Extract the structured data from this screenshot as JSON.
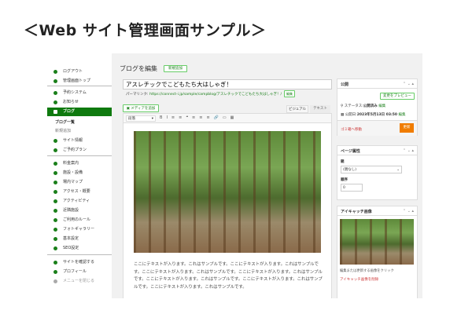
{
  "page_title": "＜Web サイト管理画面サンプル＞",
  "sidebar": {
    "items": [
      {
        "label": "ログアウト",
        "icon": "globe-icon"
      },
      {
        "label": "管理画面トップ",
        "icon": "home-icon"
      },
      {
        "label": "予約システム",
        "icon": "calendar-icon"
      },
      {
        "label": "お知らせ",
        "icon": "megaphone-icon"
      },
      {
        "label": "ブログ",
        "icon": "document-icon"
      },
      {
        "label": "ブログ一覧"
      },
      {
        "label": "新規追加"
      },
      {
        "label": "サイト情報",
        "icon": "house-icon"
      },
      {
        "label": "ご予約プラン",
        "icon": "tag-icon"
      },
      {
        "label": "料金案内",
        "icon": "receipt-icon"
      },
      {
        "label": "施設・設備",
        "icon": "flag-icon"
      },
      {
        "label": "場内マップ",
        "icon": "map-icon"
      },
      {
        "label": "アクセス・概要",
        "icon": "car-icon"
      },
      {
        "label": "アクティビティ",
        "icon": "activity-icon"
      },
      {
        "label": "近隣施設",
        "icon": "mountain-icon"
      },
      {
        "label": "ご利用のルール",
        "icon": "rules-icon"
      },
      {
        "label": "フォトギャラリー",
        "icon": "photo-icon"
      },
      {
        "label": "基本設定",
        "icon": "gear-icon"
      },
      {
        "label": "SEO設定",
        "icon": "globe-icon"
      },
      {
        "label": "サイトを確認する",
        "icon": "globe-icon"
      },
      {
        "label": "プロフィール",
        "icon": "user-icon"
      },
      {
        "label": "メニューを閉じる",
        "icon": "collapse-icon"
      }
    ]
  },
  "editor": {
    "heading": "ブログを編集",
    "new_button": "新規追加",
    "post_title": "アスレチックでこどもたち大はしゃぎ！",
    "permalink_label": "パーマリンク:",
    "permalink_url": "https://connect-i.jp/sample/campblog/アスレチックでこどもたち大はしゃぎ！/",
    "permalink_edit": "編集",
    "add_media": "メディアを追加",
    "tab_visual": "ビジュアル",
    "tab_text": "テキスト",
    "format_select": "段落",
    "toolbar": [
      "B",
      "I",
      "≡",
      "≡",
      "❝",
      "≡",
      "≡",
      "≡",
      "🔗",
      "▭",
      "▦"
    ],
    "body": "ここにテキストが入ります。これはサンプルです。ここにテキストが入ります。これはサンプルです。ここにテキストが入ります。これはサンプルです。ここにテキストが入ります。これはサンプルです。ここにテキストが入ります。これはサンプルです。ここにテキストが入ります。これはサンプルです。ここにテキストが入ります。これはサンプルです。"
  },
  "publish": {
    "title": "公開",
    "preview": "変更をプレビュー",
    "status_label": "ステータス:",
    "status": "公開済み",
    "status_edit": "編集",
    "date_label": "公開日:",
    "date": "2023年5月13日 03:50",
    "date_edit": "編集",
    "trash": "ゴミ箱へ移動",
    "update": "更新"
  },
  "attributes": {
    "title": "ページ属性",
    "parent_label": "親",
    "parent_value": "(親なし)",
    "order_label": "順序",
    "order_value": "0"
  },
  "featured": {
    "title": "アイキャッチ画像",
    "hint": "編集または更新する画像をクリック",
    "remove": "アイキャッチ画像を削除"
  },
  "colors": {
    "accent": "#0f7a0f",
    "update": "#f07c00",
    "danger": "#c33"
  }
}
